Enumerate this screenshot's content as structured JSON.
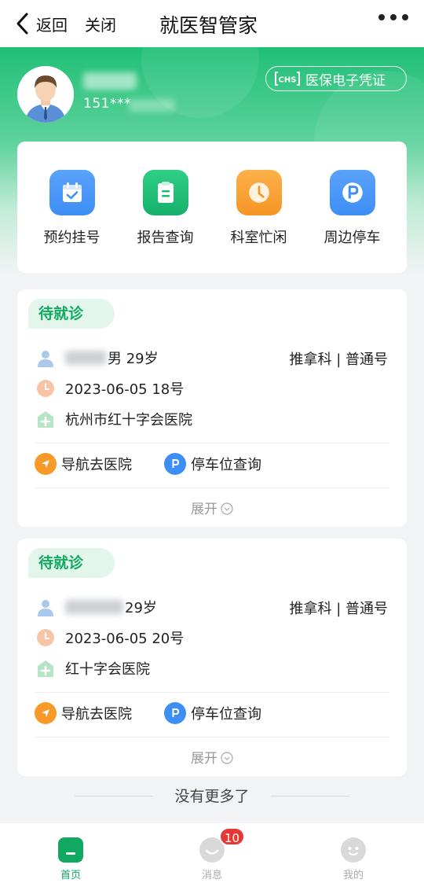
{
  "nav": {
    "back_label": "返回",
    "close_label": "关闭",
    "title": "就医智管家"
  },
  "user": {
    "phone_prefix": "151***",
    "insurance_button": "医保电子凭证",
    "insurance_logo_text": "CHS"
  },
  "menu": [
    {
      "label": "预约挂号",
      "icon": "calendar-check-icon",
      "color": "#3d8ef5"
    },
    {
      "label": "报告查询",
      "icon": "clipboard-icon",
      "color": "#1dbb74"
    },
    {
      "label": "科室忙闲",
      "icon": "clock-icon",
      "color": "#f79a2a"
    },
    {
      "label": "周边停车",
      "icon": "parking-icon",
      "color": "#3d8ef5"
    }
  ],
  "appointments": [
    {
      "status": "待就诊",
      "patient_suffix": "男 29岁",
      "department": "推拿科 | 普通号",
      "date_number": "2023-06-05  18号",
      "hospital": "杭州市红十字会医院",
      "navigate_label": "导航去医院",
      "parking_label": "停车位查询",
      "expand_label": "展开"
    },
    {
      "status": "待就诊",
      "patient_suffix": "29岁",
      "department": "推拿科 | 普通号",
      "date_number": "2023-06-05  20号",
      "hospital": "红十字会医院",
      "navigate_label": "导航去医院",
      "parking_label": "停车位查询",
      "expand_label": "展开"
    }
  ],
  "footer": {
    "no_more": "没有更多了"
  },
  "tabs": [
    {
      "label": "首页",
      "active": true
    },
    {
      "label": "消息",
      "active": false,
      "badge": "10"
    },
    {
      "label": "我的",
      "active": false
    }
  ],
  "colors": {
    "primary_green": "#11a861",
    "orange": "#f79a2a",
    "blue": "#3d8ef5",
    "badge_red": "#e53935"
  }
}
